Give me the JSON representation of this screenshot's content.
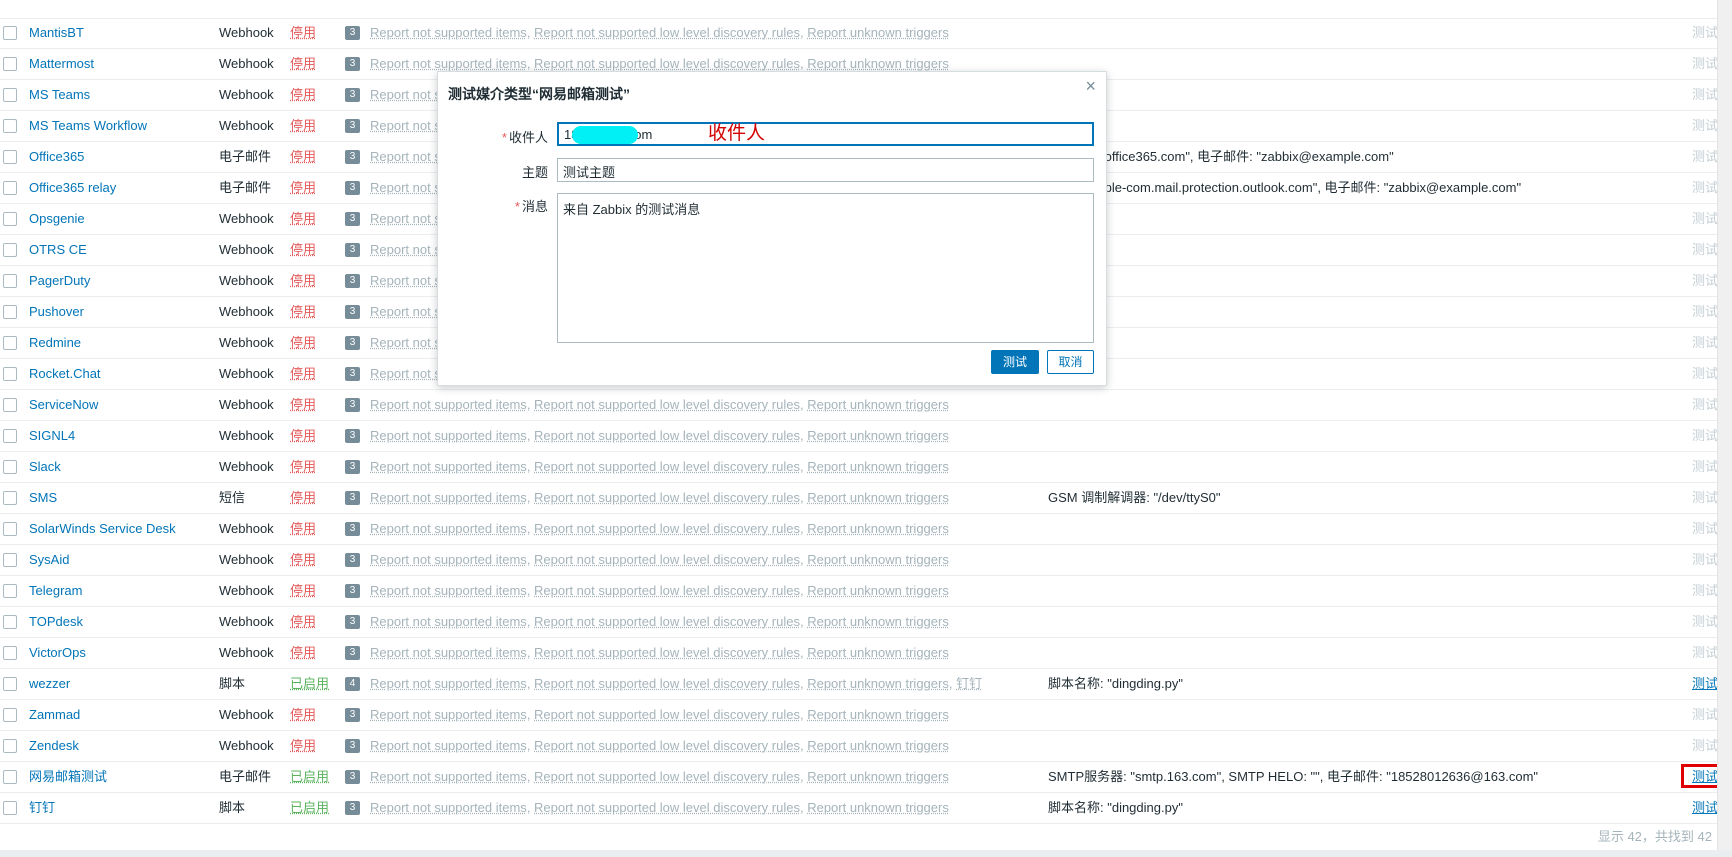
{
  "rows": [
    {
      "name": "MantisBT",
      "type": "Webhook",
      "status": "停用",
      "status_on": false,
      "count": "3",
      "details": "",
      "test": "测试",
      "test_active": false
    },
    {
      "name": "Mattermost",
      "type": "Webhook",
      "status": "停用",
      "status_on": false,
      "count": "3",
      "details": "",
      "test": "测试",
      "test_active": false
    },
    {
      "name": "MS Teams",
      "type": "Webhook",
      "status": "停用",
      "status_on": false,
      "count": "3",
      "details": "",
      "test": "测试",
      "test_active": false
    },
    {
      "name": "MS Teams Workflow",
      "type": "Webhook",
      "status": "停用",
      "status_on": false,
      "count": "3",
      "details": "",
      "test": "测试",
      "test_active": false
    },
    {
      "name": "Office365",
      "type": "电子邮件",
      "status": "停用",
      "status_on": false,
      "count": "3",
      "details": "器: \"smtp.office365.com\", 电子邮件: \"zabbix@example.com\"",
      "test": "测试",
      "test_active": false
    },
    {
      "name": "Office365 relay",
      "type": "电子邮件",
      "status": "停用",
      "status_on": false,
      "count": "3",
      "details": "器: \"example-com.mail.protection.outlook.com\", 电子邮件: \"zabbix@example.com\"",
      "test": "测试",
      "test_active": false
    },
    {
      "name": "Opsgenie",
      "type": "Webhook",
      "status": "停用",
      "status_on": false,
      "count": "3",
      "details": "",
      "test": "测试",
      "test_active": false
    },
    {
      "name": "OTRS CE",
      "type": "Webhook",
      "status": "停用",
      "status_on": false,
      "count": "3",
      "details": "",
      "test": "测试",
      "test_active": false
    },
    {
      "name": "PagerDuty",
      "type": "Webhook",
      "status": "停用",
      "status_on": false,
      "count": "3",
      "details": "",
      "test": "测试",
      "test_active": false
    },
    {
      "name": "Pushover",
      "type": "Webhook",
      "status": "停用",
      "status_on": false,
      "count": "3",
      "details": "",
      "test": "测试",
      "test_active": false
    },
    {
      "name": "Redmine",
      "type": "Webhook",
      "status": "停用",
      "status_on": false,
      "count": "3",
      "details": "",
      "test": "测试",
      "test_active": false
    },
    {
      "name": "Rocket.Chat",
      "type": "Webhook",
      "status": "停用",
      "status_on": false,
      "count": "3",
      "details": "",
      "test": "测试",
      "test_active": false
    },
    {
      "name": "ServiceNow",
      "type": "Webhook",
      "status": "停用",
      "status_on": false,
      "count": "3",
      "details": "",
      "test": "测试",
      "test_active": false
    },
    {
      "name": "SIGNL4",
      "type": "Webhook",
      "status": "停用",
      "status_on": false,
      "count": "3",
      "details": "",
      "test": "测试",
      "test_active": false
    },
    {
      "name": "Slack",
      "type": "Webhook",
      "status": "停用",
      "status_on": false,
      "count": "3",
      "details": "",
      "test": "测试",
      "test_active": false
    },
    {
      "name": "SMS",
      "type": "短信",
      "status": "停用",
      "status_on": false,
      "count": "3",
      "details": "GSM 调制解调器: \"/dev/ttyS0\"",
      "test": "测试",
      "test_active": false
    },
    {
      "name": "SolarWinds Service Desk",
      "type": "Webhook",
      "status": "停用",
      "status_on": false,
      "count": "3",
      "details": "",
      "test": "测试",
      "test_active": false
    },
    {
      "name": "SysAid",
      "type": "Webhook",
      "status": "停用",
      "status_on": false,
      "count": "3",
      "details": "",
      "test": "测试",
      "test_active": false
    },
    {
      "name": "Telegram",
      "type": "Webhook",
      "status": "停用",
      "status_on": false,
      "count": "3",
      "details": "",
      "test": "测试",
      "test_active": false
    },
    {
      "name": "TOPdesk",
      "type": "Webhook",
      "status": "停用",
      "status_on": false,
      "count": "3",
      "details": "",
      "test": "测试",
      "test_active": false
    },
    {
      "name": "VictorOps",
      "type": "Webhook",
      "status": "停用",
      "status_on": false,
      "count": "3",
      "details": "",
      "test": "测试",
      "test_active": false
    },
    {
      "name": "wezzer",
      "type": "脚本",
      "status": "已启用",
      "status_on": true,
      "count": "4",
      "details": "脚本名称: \"dingding.py\"",
      "test": "测试",
      "test_active": true,
      "extra_action": "钉钉"
    },
    {
      "name": "Zammad",
      "type": "Webhook",
      "status": "停用",
      "status_on": false,
      "count": "3",
      "details": "",
      "test": "测试",
      "test_active": false
    },
    {
      "name": "Zendesk",
      "type": "Webhook",
      "status": "停用",
      "status_on": false,
      "count": "3",
      "details": "",
      "test": "测试",
      "test_active": false
    },
    {
      "name": "网易邮箱测试",
      "type": "电子邮件",
      "status": "已启用",
      "status_on": true,
      "count": "3",
      "details": "SMTP服务器: \"smtp.163.com\", SMTP HELO: \"\", 电子邮件: \"18528012636@163.com\"",
      "test": "测试",
      "test_active": true
    },
    {
      "name": "钉钉",
      "type": "脚本",
      "status": "已启用",
      "status_on": true,
      "count": "3",
      "details": "脚本名称: \"dingding.py\"",
      "test": "测试",
      "test_active": true
    }
  ],
  "actions_text": {
    "a1": "Report not supported items",
    "sep": ", ",
    "a2": "Report not supported low level discovery rules",
    "a3": "Report unknown triggers",
    "covered": "Report not s"
  },
  "footer": "显示 42，共找到 42",
  "dialog": {
    "title": "测试媒介类型“网易邮箱测试”",
    "close": "×",
    "recipient_label": "收件人",
    "recipient_value": "18        6@163.com",
    "subject_label": "主题",
    "subject_value": "测试主题",
    "message_label": "消息",
    "message_value": "来自 Zabbix 的测试消息",
    "required_mark": "*",
    "annotation": "收件人",
    "test_button": "测试",
    "cancel_button": "取消"
  },
  "colors": {
    "link": "#0275b8",
    "disabled": "#e45959",
    "enabled": "#59b35c",
    "highlight": "#e00000"
  }
}
